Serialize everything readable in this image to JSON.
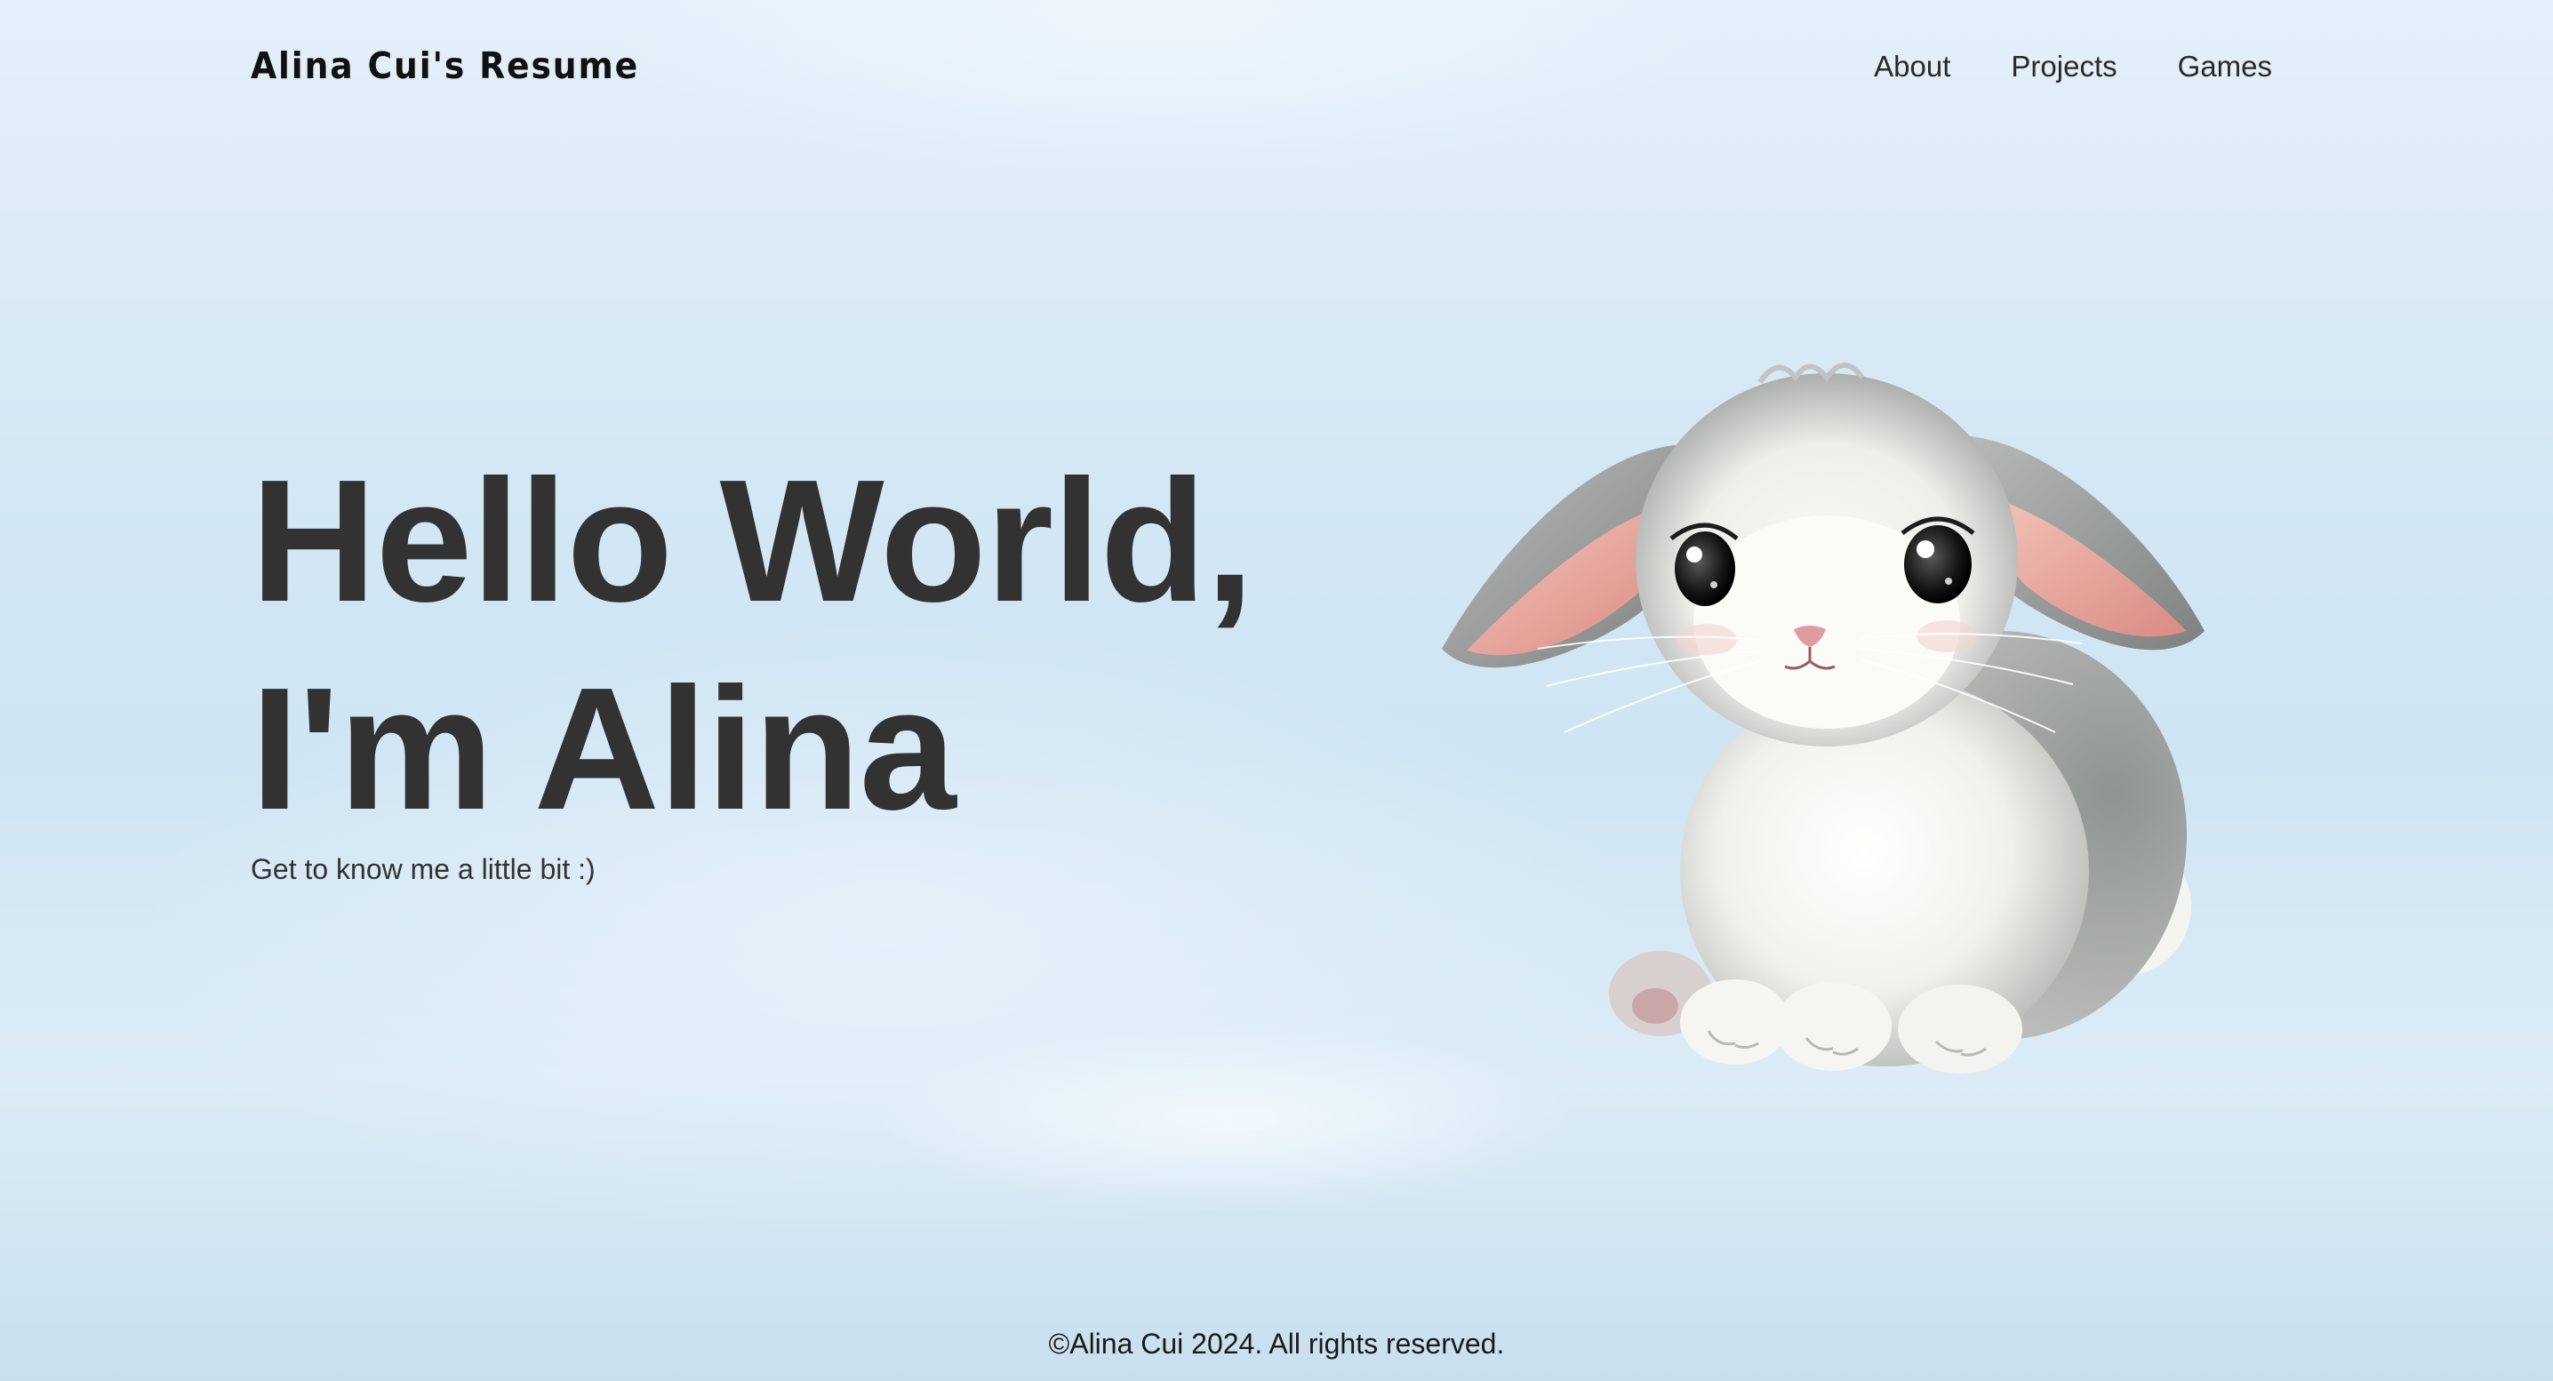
{
  "header": {
    "title": "Alina Cui's Resume",
    "nav": [
      {
        "label": "About"
      },
      {
        "label": "Projects"
      },
      {
        "label": "Games"
      }
    ]
  },
  "hero": {
    "line1": "Hello World,",
    "line2": "I'm Alina",
    "subtitle": "Get to know me a little bit :)"
  },
  "illustration": {
    "icon": "bunny-illustration"
  },
  "footer": {
    "text": "©Alina Cui 2024. All rights reserved."
  },
  "colors": {
    "background_top": "#e4f0f9",
    "background_mid": "#d3e7f4",
    "heading": "#323232",
    "text": "#2a2a2a"
  }
}
